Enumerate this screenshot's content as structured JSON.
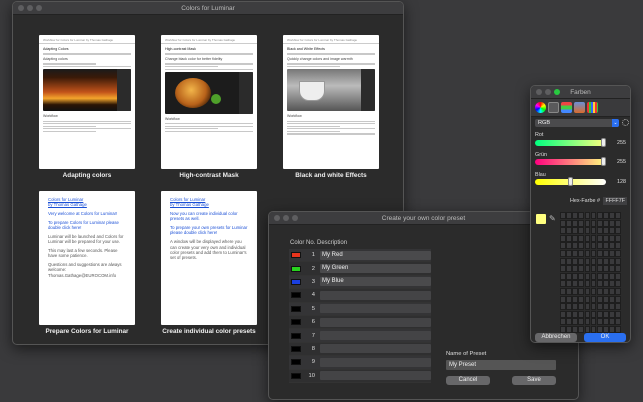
{
  "main_window": {
    "title": "Colors for Luminar",
    "cards": [
      {
        "caption": "Adapting colors",
        "heading": "Adapting Colors",
        "header": "Workflow for Colors for Luminar by Thomas Gathage",
        "sub": "Adapting colors",
        "workflow": "Workflow"
      },
      {
        "caption": "High-contrast Mask",
        "heading": "High-contrast Mask",
        "header": "Workflow for Colors for Luminar by Thomas Gathage",
        "sub": "Change black color for better fidelity",
        "workflow": "Workflow"
      },
      {
        "caption": "Black and white Effects",
        "heading": "Black and White Effects",
        "header": "Workflow for Colors for Luminar by Thomas Gathage",
        "sub": "Quickly change colors and image warmth",
        "workflow": "Workflow"
      }
    ],
    "prep_card": {
      "caption": "Prepare Colors for Luminar",
      "title1": "Colors for Luminar",
      "title2": "by Thomas Gathage",
      "p1": "Very welcome at Colors for Luminar!",
      "p2": "To prepare Colors for Luminar please double click here!",
      "p3": "Luminar will be launched and Colors for Luminar will be prepared for your use.",
      "p4": "This may last a few seconds. Please have some patience.",
      "p5": "Questions and suggestions are always welcome: Thomas.Gathage@EUROCOM.info"
    },
    "indiv_card": {
      "caption": "Create individual color presets",
      "title1": "Colors for Luminar",
      "title2": "by Thomas Gathage",
      "p1": "Now you can create individual color presets as well.",
      "p2": "To prepare your own presets for Luminar please double click here!",
      "p3": "A window will be displayed where you can create your very own and individual color presets and add them to Luminar's set of presets."
    }
  },
  "preset_window": {
    "title": "Create your own color preset",
    "col_no": "Color No.",
    "col_desc": "Description",
    "rows": [
      {
        "no": "1",
        "name": "My Red",
        "color": "#e8341c"
      },
      {
        "no": "2",
        "name": "My Green",
        "color": "#28d21e"
      },
      {
        "no": "3",
        "name": "My Blue",
        "color": "#1a3fe0"
      },
      {
        "no": "4",
        "name": "",
        "color": "#000000"
      },
      {
        "no": "5",
        "name": "",
        "color": "#000000"
      },
      {
        "no": "6",
        "name": "",
        "color": "#000000"
      },
      {
        "no": "7",
        "name": "",
        "color": "#000000"
      },
      {
        "no": "8",
        "name": "",
        "color": "#000000"
      },
      {
        "no": "9",
        "name": "",
        "color": "#000000"
      },
      {
        "no": "10",
        "name": "",
        "color": "#000000"
      }
    ],
    "name_label": "Name of Preset",
    "name_value": "My Preset",
    "cancel": "Cancel",
    "save": "Save"
  },
  "colors_panel": {
    "title": "Farben",
    "mode": "RGB",
    "red_label": "Rot",
    "red_value": 255,
    "green_label": "Grün",
    "green_value": 255,
    "blue_label": "Blau",
    "blue_value": 128,
    "hex_label": "Hex-Farbe #",
    "hex_value": "FFFF7F",
    "cancel": "Abbrechen",
    "ok": "OK",
    "current_color": "#ffff7f",
    "accent": "#2a6ff0"
  }
}
